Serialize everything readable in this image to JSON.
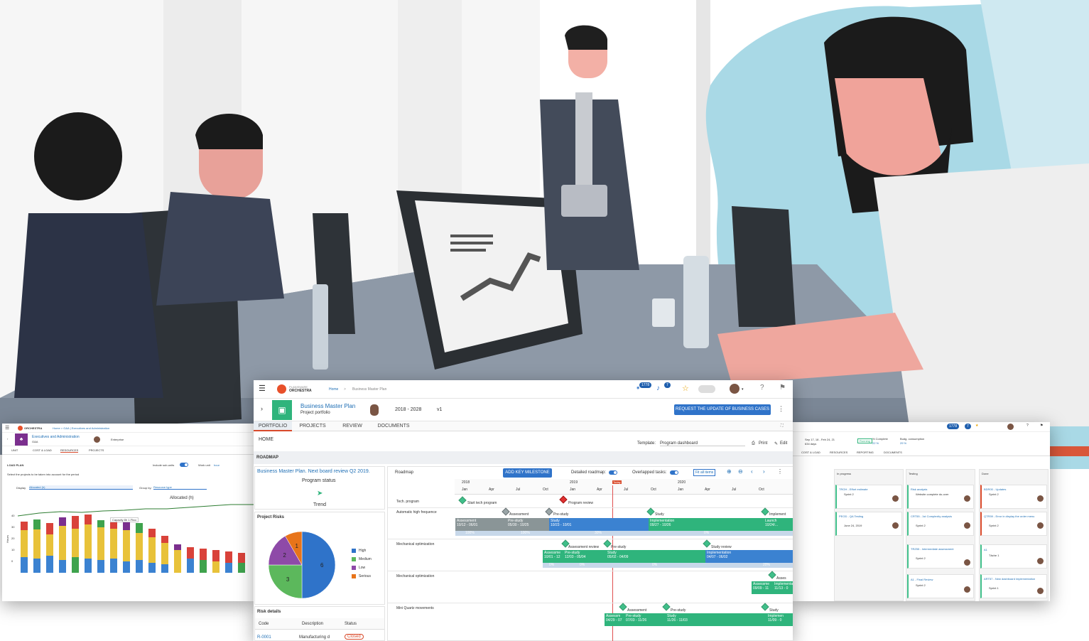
{
  "colors": {
    "accent": "#2f73c9",
    "brand_orange": "#e8502a",
    "green": "#2fb47c",
    "gray_bar": "#8a9597",
    "blue_bar": "#3b82d1"
  },
  "main": {
    "brand_top": "PLANISWARE",
    "brand_name": "ORCHESTRA",
    "breadcrumb_home": "Home",
    "breadcrumb_sep": ">",
    "breadcrumb_current": "Business Master Plan",
    "notif_rss_count": "1778",
    "notif_bell_count": "7",
    "project_title": "Business Master Plan",
    "project_subtitle": "Project portfolio",
    "period": "2018 - 2028",
    "version": "v1",
    "request_button": "REQUEST THE UPDATE OF BUSINESS CASES",
    "tabs": [
      "PORTFOLIO",
      "PROJECTS",
      "REVIEW",
      "DOCUMENTS"
    ],
    "home_label": "HOME",
    "template_label": "Template:",
    "template_value": "Program dashboard",
    "print_label": "Print",
    "edit_label": "Edit",
    "roadmap_section": "ROADMAP",
    "board_review_title": "Business Master Plan. Next board review Q2 2019.",
    "program_status": "Program status",
    "trend_label": "Trend",
    "project_risks": "Project Risks",
    "risk_details": "Risk details",
    "risk_columns": [
      "Code",
      "Description",
      "Status"
    ],
    "risk_row": [
      "R-0001",
      "Manufacturing d",
      "Closed"
    ],
    "roadmap_label": "Roadmap",
    "add_milestone": "ADD KEY MILESTONE",
    "detailed_roadmap": "Detailed roadmap:",
    "overlapped_tasks": "Overlapped tasks:",
    "fit_all": "Fit all items",
    "years": [
      "2018",
      "2019",
      "2020"
    ],
    "months": [
      "Jan",
      "Apr",
      "Jul",
      "Oct",
      "Jan",
      "Apr",
      "Jul",
      "Oct",
      "Jan",
      "Apr",
      "Jul",
      "Oct"
    ],
    "today_label": "Today",
    "rows": [
      "Tech. program",
      "Automatic high frequence",
      "Mechanical optimization",
      "Mechanical optimization",
      "Mini Quartz movements"
    ],
    "milestones": {
      "start_tech": "Start tech program",
      "program_review": "Program review",
      "assessment": "Assessment",
      "prestudy": "Pre-study",
      "study": "Study",
      "implement": "Implement",
      "assessment_review": "Assessment review",
      "study_review": "Study review",
      "asses_trunc": "Asses"
    },
    "row1_bars": {
      "assessment": {
        "name": "Assessment",
        "dates": "10/12 - 06/01",
        "pct": "100%"
      },
      "prestudy": {
        "name": "Pre-study",
        "dates": "05/30 - 10/25",
        "pct": "100%"
      },
      "study": {
        "name": "Study",
        "dates": "10/23 - 10/01",
        "pct": "30%"
      },
      "implementation": {
        "name": "Implementation",
        "dates": "09/27 - 10/26",
        "pct": "0%"
      },
      "launch": {
        "name": "Launch",
        "dates": "10/24/..."
      }
    },
    "row2_bars": {
      "assessment": {
        "name": "Assessme",
        "dates": "10/01 - 12",
        "pct": "0%"
      },
      "prestudy": {
        "name": "Pre-study",
        "dates": "12/03 - 05/04",
        "pct": "0%"
      },
      "study": {
        "name": "Study",
        "dates": "05/02 - 04/09",
        "pct": "0%"
      },
      "implementation": {
        "name": "Implementation",
        "dates": "04/07 - 06/02",
        "pct": "20%"
      }
    },
    "row3_bars": {
      "assessment": {
        "name": "Assessme",
        "dates": "09/09 - 11",
        "extra": "Implementa",
        "extra_dates": "11/13 - 0"
      }
    },
    "row4_bars": {
      "assessment": {
        "name": "Assessm",
        "dates": "04/29 - 07"
      },
      "prestudy": {
        "name": "Pre-study",
        "dates": "07/03 - 11/26"
      },
      "study": {
        "name": "Study",
        "dates": "11/26 - 11/03"
      },
      "implementation": {
        "name": "Implemen",
        "dates": "11/09 - 0"
      }
    }
  },
  "chart_data": {
    "type": "pie",
    "categories": [
      "High",
      "Medium",
      "Low",
      "Serious"
    ],
    "values": [
      6,
      3,
      2,
      1
    ],
    "title": "Project Risks"
  },
  "left": {
    "brand": "ORCHESTRA",
    "breadcrumb": "Home > G&A | Executives and Administration",
    "unit_title": "Executives and Administration",
    "unit_sub": "G&A",
    "enterprise": "Enterprise",
    "tabs": [
      "UNIT",
      "COST & LOAD",
      "RESOURCES",
      "PROJECTS"
    ],
    "load_plan": "LOAD PLAN",
    "include_subunits": "Include sub-units",
    "work_unit": "Work unit",
    "work_unit_value": "hour",
    "instruction": "Select the projects to be taken into account for the period",
    "display_label": "Display",
    "display_value": "Allocated (h)",
    "group_by_label": "Group by:",
    "group_by_value": "Resource type",
    "chart_title": "Allocated (h)",
    "capacity_tooltip": "Capacity 8h 1.Fhcc",
    "y_ticks": [
      "40",
      "30",
      "20",
      "10",
      "0"
    ],
    "y_label": "Hours"
  },
  "right": {
    "notif_rss": "1778",
    "notif_bell": "7",
    "dates": "Sep 17, 18 - Feb 24, 21",
    "days": "634 days",
    "status": "Running",
    "pct_complete_label": "% Complete",
    "pct_complete": "22 %",
    "budget_label": "Budg. consumption",
    "budget": "29 %",
    "tabs": [
      "COST & LOAD",
      "RESOURCES",
      "REPORTING",
      "DOCUMENTS"
    ],
    "columns": [
      "In progress",
      "Testing",
      "Done"
    ],
    "cards_inprogress": [
      {
        "title": "TRGH - Effort estimate",
        "meta": "Sprint 2"
      },
      {
        "title": "PEOD - QA Testing",
        "meta": "June 24, 2019"
      }
    ],
    "cards_testing": [
      {
        "title": "Risk analysis",
        "meta": "Website complete do-over"
      },
      {
        "title": "CRT55 - 1st Complexity analysis",
        "meta": "Sprint 2"
      },
      {
        "title": "TRZ55 - Intermediate assessment",
        "meta": "Sprint 2"
      },
      {
        "title": "A1 - Final Review",
        "meta": "Sprint 2"
      }
    ],
    "cards_done": [
      {
        "title": "BDR00 - Updates",
        "meta": "Sprint 2"
      },
      {
        "title": "QTR59 - Error in display the order menu",
        "meta": "Sprint 2"
      },
      {
        "title": "A1",
        "meta": "Tâche 1"
      },
      {
        "title": "ART57 - New dashboard implementation",
        "meta": "Sprint 1"
      }
    ]
  }
}
